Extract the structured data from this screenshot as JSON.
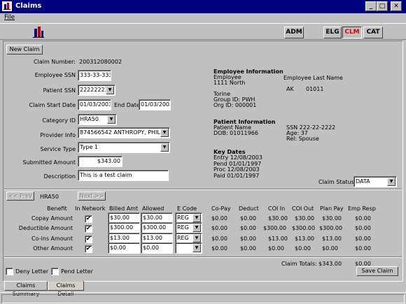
{
  "window": {
    "title": "Claims",
    "minimize": "_",
    "maximize": "□",
    "close": "✕"
  },
  "menu": {
    "file": "File"
  },
  "toolbar": {
    "adm": "ADM",
    "elg": "ELG",
    "clm": "CLM",
    "cat": "CAT"
  },
  "form": {
    "new_claim": "New Claim",
    "claim_number_label": "Claim Number:",
    "claim_number": "200312080002",
    "employee_ssn_label": "Employee SSN",
    "employee_ssn": "333-33-3333",
    "patient_ssn_label": "Patient SSN",
    "patient_ssn": "222222222",
    "claim_start_label": "Claim Start Date",
    "claim_start": "01/03/2003",
    "end_date_label": "End Date",
    "end_date": "01/03/2003",
    "category_label": "Category ID",
    "category": "HRA50",
    "provider_label": "Provider Info",
    "provider": "874566542 ANTHROPY, PHIL",
    "service_type_label": "Service Type",
    "service_type": "Type 1",
    "submitted_label": "Submitted Amount",
    "submitted": "$343.00",
    "description_label": "Description",
    "description": "This is a test claim"
  },
  "info": {
    "emp_heading": "Employee Information",
    "emp_col1": [
      "Employee",
      "1111 North",
      "Torine",
      "Group ID: PWH",
      "Org ID: 000001"
    ],
    "emp_last": "Employee Last Name",
    "emp_state": "AK",
    "emp_zip": "01011",
    "pat_heading": "Patient  Information",
    "pat_col1": [
      "Patient Name",
      "DOB: 01011966"
    ],
    "pat_col2": [
      "SSN 222-22-2222",
      "Age: 37",
      "Rel: Spouse"
    ],
    "key_heading": "Key Dates",
    "key_dates": [
      "Entry 12/08/2003",
      "Pend 01/01/1997",
      "Proc 12/08/2003",
      "Paid  01/01/1997"
    ],
    "claim_status_label": "Claim Status:",
    "claim_status": "DATA"
  },
  "nav": {
    "prev": "<< Prev",
    "category": "HRA50",
    "next": "Next >>"
  },
  "table": {
    "headers": [
      "Benefit",
      "In Network",
      "Billed Amt",
      "Allowed",
      "E Code",
      "Co-Pay",
      "Deduct",
      "COI In",
      "COI Out",
      "Plan Pay",
      "Emp Resp"
    ],
    "rows": [
      {
        "benefit": "Copay Amount",
        "check": "✔",
        "billed": "$30.00",
        "allowed": "$30.00",
        "ecode": "REG",
        "copay": "$0.00",
        "deduct": "$0.00",
        "coi_in": "$30.00",
        "coi_out": "$30.00",
        "plan_pay": "$30.00",
        "emp_resp": "$0.00"
      },
      {
        "benefit": "Deductible Amount",
        "check": "✔",
        "billed": "$300.00",
        "allowed": "$300.00",
        "ecode": "REG",
        "copay": "$0.00",
        "deduct": "$0.00",
        "coi_in": "$300.00",
        "coi_out": "$300.00",
        "plan_pay": "$300.00",
        "emp_resp": "$0.00"
      },
      {
        "benefit": "Co-ins Amount",
        "check": "✔",
        "billed": "$13.00",
        "allowed": "$13.00",
        "ecode": "REG",
        "copay": "$0.00",
        "deduct": "$0.00",
        "coi_in": "$13.00",
        "coi_out": "$13.00",
        "plan_pay": "$13.00",
        "emp_resp": "$0.00"
      },
      {
        "benefit": "Other Amount",
        "check": "✔",
        "billed": "$0.00",
        "allowed": "$0.00",
        "ecode": "",
        "copay": "$0.00",
        "deduct": "$0.00",
        "coi_in": "$0.00",
        "coi_out": "$0.00",
        "plan_pay": "$0.00",
        "emp_resp": "$0.00"
      }
    ]
  },
  "totals": {
    "label": "Claim Totals:",
    "total": "$343.00",
    "emp_resp": "$0.00"
  },
  "footer": {
    "deny_letter": "Deny Letter",
    "pend_letter": "Pend Letter",
    "save_claim": "Save Claim"
  },
  "tabs": {
    "summary": "Claims Summary",
    "detail": "Claims Detail"
  },
  "colors": {
    "titlebar": "#000080",
    "active_module": "#e00000",
    "window_bg": "#c0c0c0"
  }
}
